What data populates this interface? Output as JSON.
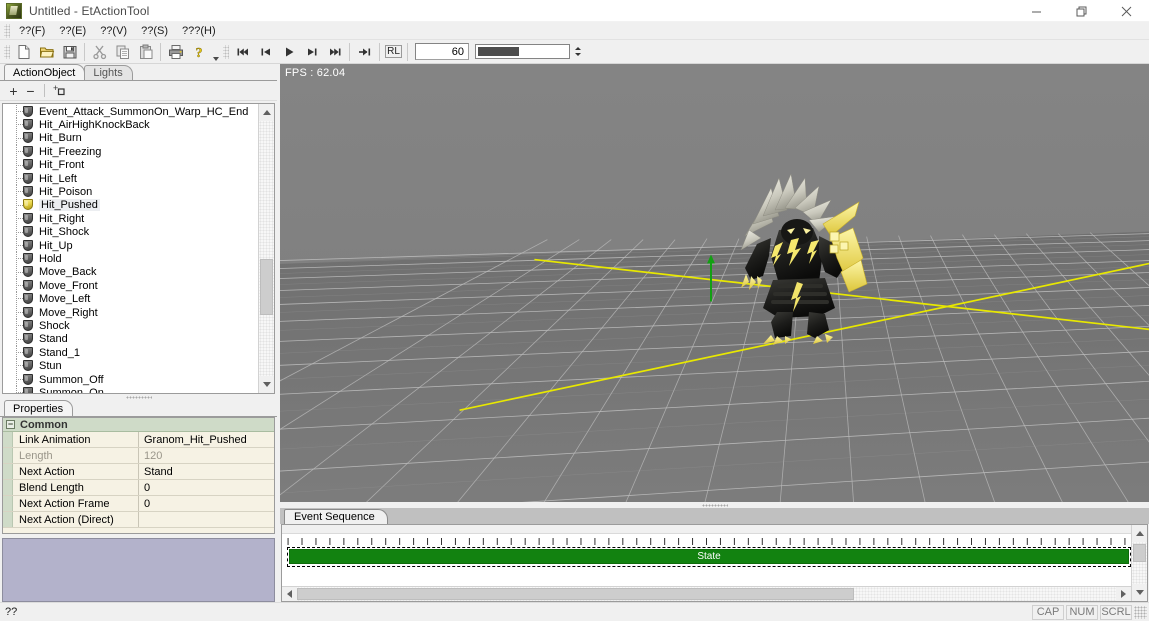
{
  "window": {
    "title": "Untitled - EtActionTool",
    "app_icon": "app-logo-icon",
    "minimize_label": "—",
    "maximize_label": "❐",
    "close_label": "✕"
  },
  "menubar": {
    "items": [
      {
        "label": "??(F)"
      },
      {
        "label": "??(E)"
      },
      {
        "label": "??(V)"
      },
      {
        "label": "??(S)"
      },
      {
        "label": "???(H)"
      }
    ]
  },
  "toolbar": {
    "buttons": [
      {
        "name": "new-file-button",
        "icon": "new-document-icon"
      },
      {
        "name": "open-file-button",
        "icon": "open-folder-icon"
      },
      {
        "name": "save-file-button",
        "icon": "floppy-disk-icon"
      },
      {
        "name": "cut-button",
        "icon": "scissors-icon"
      },
      {
        "name": "copy-button",
        "icon": "copy-icon"
      },
      {
        "name": "paste-button",
        "icon": "clipboard-icon"
      },
      {
        "name": "print-button",
        "icon": "printer-icon"
      },
      {
        "name": "help-button",
        "icon": "question-key-icon"
      }
    ],
    "playback": [
      {
        "name": "first-frame-button",
        "icon": "skip-to-start-icon"
      },
      {
        "name": "prev-frame-button",
        "icon": "step-back-icon"
      },
      {
        "name": "play-button",
        "icon": "play-icon"
      },
      {
        "name": "next-frame-button",
        "icon": "step-forward-icon"
      },
      {
        "name": "last-frame-button",
        "icon": "skip-to-end-icon"
      },
      {
        "name": "end-button",
        "icon": "jump-to-end-icon"
      }
    ],
    "loop_button_label": "RL",
    "frame_value": "60",
    "frame_slider_percent": 46
  },
  "left_panel": {
    "tabs": [
      {
        "label": "ActionObject",
        "active": true
      },
      {
        "label": "Lights",
        "active": false
      }
    ],
    "tree_toolbar": [
      {
        "name": "add-item-button",
        "label": "+"
      },
      {
        "name": "remove-item-button",
        "label": "−"
      },
      {
        "name": "new-folder-button",
        "label": "folder"
      }
    ],
    "tree_items": [
      {
        "label": "Event_Attack_SummonOn_Warp_HC_End",
        "selected": false
      },
      {
        "label": "Hit_AirHighKnockBack",
        "selected": false
      },
      {
        "label": "Hit_Burn",
        "selected": false
      },
      {
        "label": "Hit_Freezing",
        "selected": false
      },
      {
        "label": "Hit_Front",
        "selected": false
      },
      {
        "label": "Hit_Left",
        "selected": false
      },
      {
        "label": "Hit_Poison",
        "selected": false
      },
      {
        "label": "Hit_Pushed",
        "selected": true
      },
      {
        "label": "Hit_Right",
        "selected": false
      },
      {
        "label": "Hit_Shock",
        "selected": false
      },
      {
        "label": "Hit_Up",
        "selected": false
      },
      {
        "label": "Hold",
        "selected": false
      },
      {
        "label": "Move_Back",
        "selected": false
      },
      {
        "label": "Move_Front",
        "selected": false
      },
      {
        "label": "Move_Left",
        "selected": false
      },
      {
        "label": "Move_Right",
        "selected": false
      },
      {
        "label": "Shock",
        "selected": false
      },
      {
        "label": "Stand",
        "selected": false
      },
      {
        "label": "Stand_1",
        "selected": false
      },
      {
        "label": "Stun",
        "selected": false
      },
      {
        "label": "Summon_Off",
        "selected": false
      },
      {
        "label": "Summon_On",
        "selected": false
      }
    ]
  },
  "properties": {
    "tab_label": "Properties",
    "category_label": "Common",
    "rows": [
      {
        "name": "Link Animation",
        "value": "Granom_Hit_Pushed",
        "dim": false
      },
      {
        "name": "Length",
        "value": "120",
        "dim": true
      },
      {
        "name": "Next Action",
        "value": "Stand",
        "dim": false
      },
      {
        "name": "Blend Length",
        "value": "0",
        "dim": false
      },
      {
        "name": "Next Action Frame",
        "value": "0",
        "dim": false
      },
      {
        "name": "Next Action (Direct)",
        "value": "",
        "dim": false
      }
    ]
  },
  "viewport": {
    "fps_label": "FPS : 62.04",
    "background_color": "#808080",
    "grid_line_color": "#b9b9b9",
    "axis_color": "#e8e800",
    "z_axis_color": "#12a012"
  },
  "event_sequence": {
    "tab_label": "Event Sequence",
    "track_label": "State",
    "track_color": "#128210",
    "hscroll_thumb_percent": 68
  },
  "statusbar": {
    "message": "??",
    "indicators": [
      "CAP",
      "NUM",
      "SCRL"
    ]
  }
}
